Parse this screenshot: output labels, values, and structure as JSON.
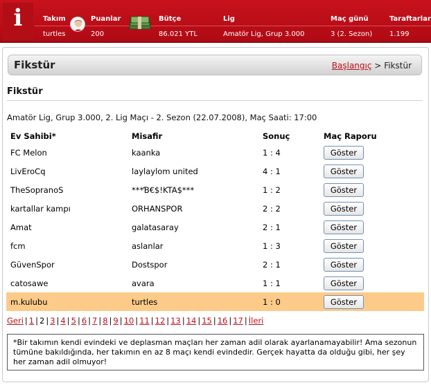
{
  "topbar": {
    "info_letter": "i",
    "labels": {
      "team": "Takım",
      "points": "Puanlar",
      "budget": "Bütçe",
      "league": "Lig",
      "matchday": "Maç günü",
      "fans": "Taraftarlar"
    },
    "values": {
      "team": "turtles",
      "points": "200",
      "budget": "86.021 YTL",
      "league": "Amatör Lig, Grup 3.000",
      "matchday": "3 (2. Sezon)",
      "fans": "1.199"
    },
    "accent_color": "#c8121c"
  },
  "header": {
    "title": "Fikstür",
    "breadcrumb_home": "Başlangıç",
    "breadcrumb_sep": ">",
    "breadcrumb_current": "Fikstür"
  },
  "section": {
    "title": "Fikstür",
    "match_info": "Amatör Lig, Grup 3.000, 2. Lig Maçı - 2. Sezon (22.07.2008), Maç Saati: 17:00"
  },
  "table": {
    "headers": {
      "home": "Ev Sahibi*",
      "away": "Misafir",
      "result": "Sonuç",
      "report": "Maç Raporu"
    },
    "button_label": "Göster",
    "highlight_color": "#fccb8a",
    "rows": [
      {
        "home": "FC Melon",
        "away": "kaanka",
        "result": "1 : 4"
      },
      {
        "home": "LivEroCq",
        "away": "laylaylom united",
        "result": "4 : 1"
      },
      {
        "home": "TheSopranoS",
        "away": "***Ɓ€$!KTA$***",
        "result": "1 : 2"
      },
      {
        "home": "kartallar kampı",
        "away": "ORHANSPOR",
        "result": "2 : 2"
      },
      {
        "home": "Amat",
        "away": "galatasaray",
        "result": "2 : 1"
      },
      {
        "home": "fcm",
        "away": "aslanlar",
        "result": "1 : 3"
      },
      {
        "home": "GüvenSpor",
        "away": "Dostspor",
        "result": "2 : 1"
      },
      {
        "home": "catosawe",
        "away": "avara",
        "result": "1 : 1"
      },
      {
        "home": "m.kulubu",
        "away": "turtles",
        "result": "1 : 0"
      }
    ]
  },
  "pager": {
    "prev": "Geri",
    "next": "İleri",
    "current": "2",
    "pages": [
      "1",
      "2",
      "3",
      "4",
      "5",
      "6",
      "7",
      "8",
      "9",
      "10",
      "11",
      "12",
      "13",
      "14",
      "15",
      "16",
      "17"
    ]
  },
  "note": "*Bir takımın kendi evindeki ve deplasman maçları her zaman adil olarak ayarlanamayabilir! Ama sezonun tümüne bakıldığında, her takımın en az 8 maçı kendi evindedir. Gerçek hayatta da olduğu gibi, her şey her zaman adil olmuyor!"
}
